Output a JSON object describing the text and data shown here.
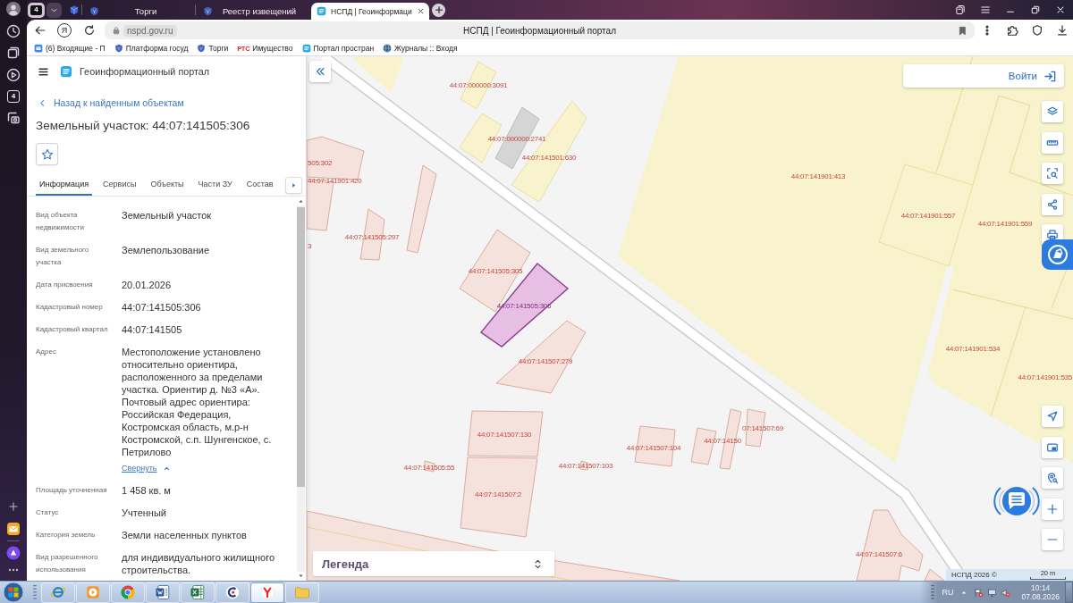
{
  "browser": {
    "sidebar_counter": "4",
    "tab_counter": "4",
    "tabs": [
      {
        "title": "Торги",
        "selected": false
      },
      {
        "title": "Реестр извещений",
        "selected": false
      },
      {
        "title": "НСПД | Геоинформаци",
        "selected": true
      }
    ],
    "home_button": "Я",
    "address": {
      "url": "nspd.gov.ru",
      "page_title": "НСПД | Геоинформационный портал"
    },
    "bookmarks": [
      {
        "label": "(6) Входящие - П"
      },
      {
        "label": "Платформа госуд"
      },
      {
        "label": "Торги"
      },
      {
        "label": "Имущество",
        "favicon_text": "РТС"
      },
      {
        "label": "Портал простран"
      },
      {
        "label": "Журналы :: Входя"
      }
    ]
  },
  "portal": {
    "header_title": "Геоинформационный портал",
    "back_link": "Назад к найденным объектам",
    "object_title": "Земельный участок: 44:07:141505:306",
    "starred": false,
    "tabs": [
      {
        "label": "Информация",
        "selected": true
      },
      {
        "label": "Сервисы",
        "selected": false
      },
      {
        "label": "Объекты",
        "selected": false
      },
      {
        "label": "Части ЗУ",
        "selected": false
      },
      {
        "label": "Состав",
        "selected": false
      }
    ],
    "properties": [
      {
        "label": "Вид объекта недвижимости",
        "value": "Земельный участок"
      },
      {
        "label": "Вид земельного участка",
        "value": "Землепользование"
      },
      {
        "label": "Дата присвоения",
        "value": "20.01.2026"
      },
      {
        "label": "Кадастровый номер",
        "value": "44:07:141505:306"
      },
      {
        "label": "Кадастровый квартал",
        "value": "44:07:141505"
      },
      {
        "label": "Адрес",
        "value": "Местоположение установлено относительно ориентира, расположенного за пределами участка. Ориентир д. №3 «А». Почтовый адрес ориентира: Российская Федерация, Костромская область, м.р-н Костромской, с.п. Шунгенское, с. Петрилово",
        "toggle_link": "Свернуть"
      },
      {
        "label": "Площадь уточненная",
        "value": "1 458 кв. м"
      },
      {
        "label": "Статус",
        "value": "Учтенный"
      },
      {
        "label": "Категория земель",
        "value": "Земли населенных пунктов"
      },
      {
        "label": "Вид разрешенного использования",
        "value": "для индивидуального жилищного строительства."
      }
    ]
  },
  "map": {
    "login": "Войти",
    "parcels": [
      {
        "label": "44:07:000000:3091",
        "selected": false
      },
      {
        "label": "44:07:000000:2741",
        "selected": false
      },
      {
        "label": "44:07:141501:630",
        "selected": false
      },
      {
        "label": "505:302",
        "selected": false
      },
      {
        "label": "44:07:141901:413",
        "selected": false
      },
      {
        "label": "44:07:141901:420",
        "selected": false
      },
      {
        "label": "44:07:141901:557",
        "selected": false
      },
      {
        "label": "44:07:141901:559",
        "selected": false
      },
      {
        "label": "44:07:141505:297",
        "selected": false
      },
      {
        "label": "3",
        "selected": false
      },
      {
        "label": "44:07:141505:305",
        "selected": false
      },
      {
        "label": "44:07:141505:306",
        "selected": true
      },
      {
        "label": "44:07:141901:534",
        "selected": false
      },
      {
        "label": "44:07:141507:279",
        "selected": false
      },
      {
        "label": "44:07:141901:535",
        "selected": false
      },
      {
        "label": "07:141507:69",
        "selected": false
      },
      {
        "label": "44:07:141507:130",
        "selected": false
      },
      {
        "label": "44:07:14150",
        "selected": false
      },
      {
        "label": "44:07:141507:104",
        "selected": false
      },
      {
        "label": "44:07:141507:103",
        "selected": false
      },
      {
        "label": "44:07:141505:55",
        "selected": false
      },
      {
        "label": "44:07:141507:2",
        "selected": false
      },
      {
        "label": "44:07:141507:6",
        "selected": false
      }
    ],
    "legend": "Легенда",
    "attribution": "НСПД 2026 ©",
    "scale": "20 m"
  },
  "taskbar": {
    "apps": [
      {
        "selected": false
      },
      {
        "selected": false
      },
      {
        "selected": false
      },
      {
        "selected": false
      },
      {
        "selected": false
      },
      {
        "selected": false
      },
      {
        "selected": true
      },
      {
        "selected": false
      }
    ],
    "language": "RU",
    "time": "10:14",
    "date": "07.08.2026"
  }
}
